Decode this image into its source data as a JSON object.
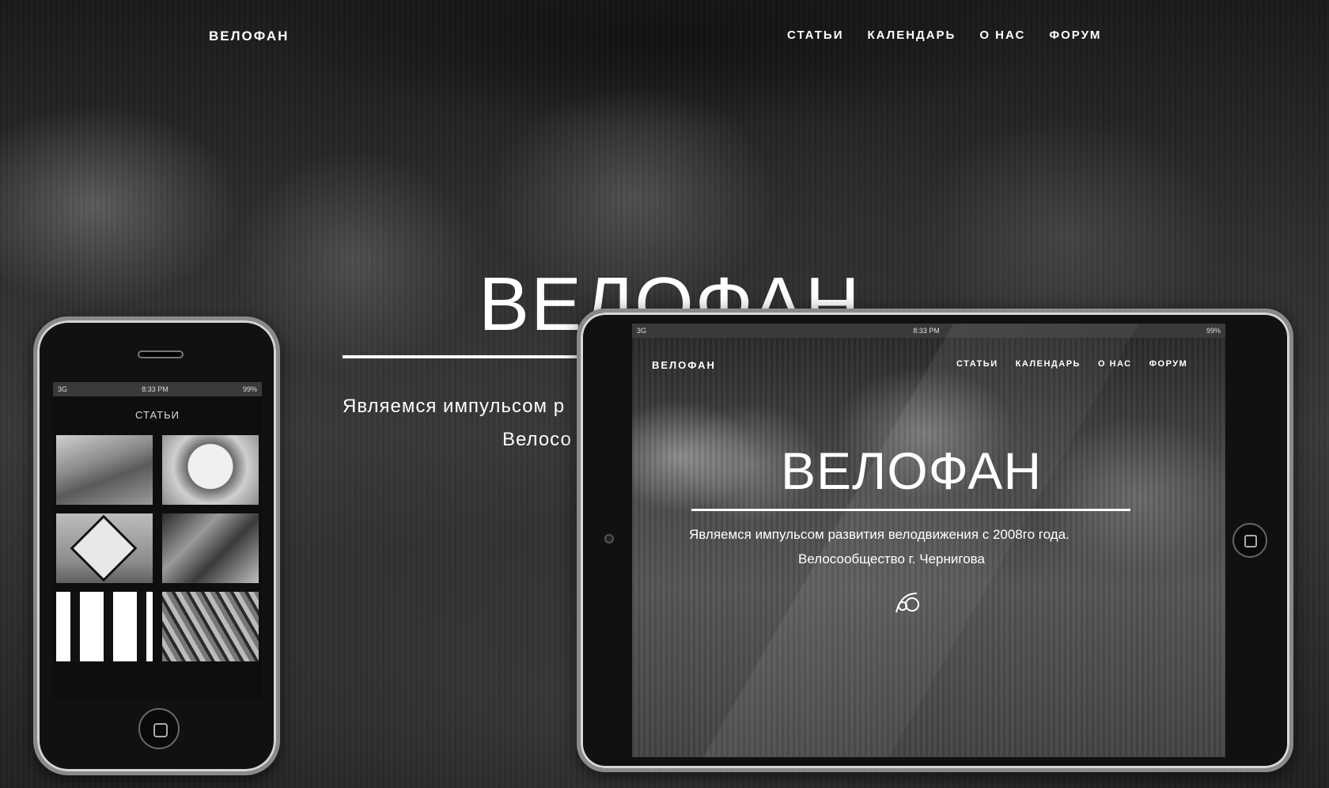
{
  "background_site": {
    "logo": "ВЕЛОФАН",
    "nav": [
      "СТАТЬИ",
      "КАЛЕНДАРЬ",
      "О НАС",
      "ФОРУМ"
    ],
    "hero_title": "ВЕЛОФАН",
    "hero_subtitle": "Являемся импульсом р",
    "hero_subtitle_2": "Велосо"
  },
  "phone": {
    "status": {
      "signal": "3G",
      "time": "8:33 PM",
      "battery": "99%"
    },
    "page_title": "СТАТЬИ"
  },
  "tablet": {
    "status": {
      "signal": "3G",
      "time": "8:33 PM",
      "battery": "99%"
    },
    "logo": "ВЕЛОФАН",
    "nav": [
      "СТАТЬИ",
      "КАЛЕНДАРЬ",
      "О НАС",
      "ФОРУМ"
    ],
    "hero_title": "ВЕЛОФАН",
    "hero_subtitle": "Являемся импульсом развития велодвижения с 2008го года.",
    "hero_subtitle_2": "Велосообщество г. Чернигова"
  }
}
